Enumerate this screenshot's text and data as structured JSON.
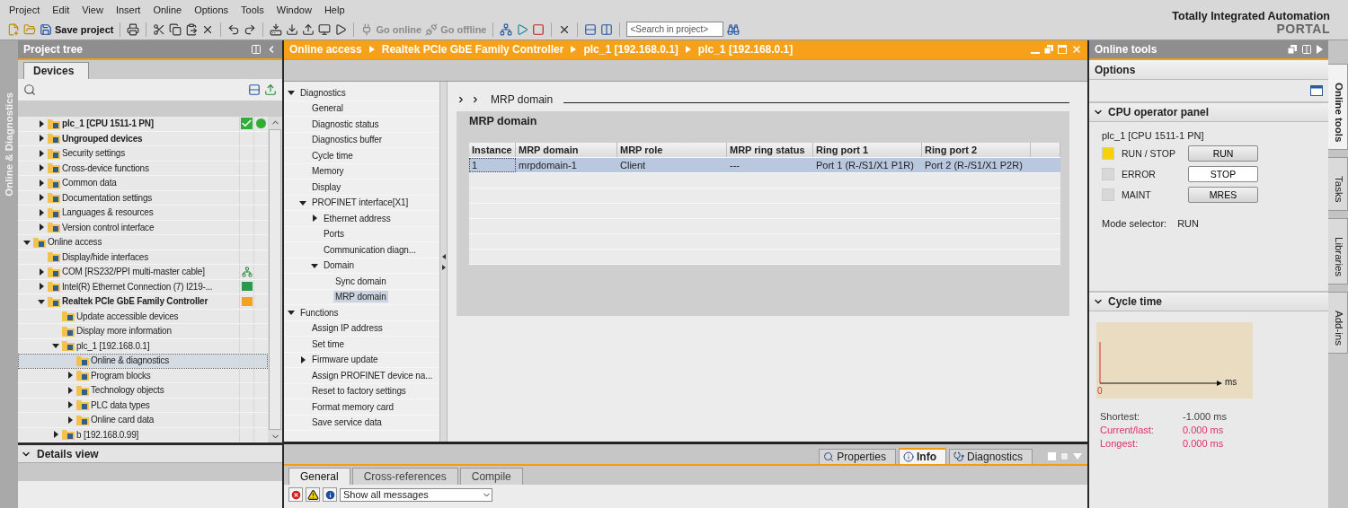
{
  "menu": [
    "Project",
    "Edit",
    "View",
    "Insert",
    "Online",
    "Options",
    "Tools",
    "Window",
    "Help"
  ],
  "toolbar": {
    "save_label": "Save project",
    "go_online": {
      "label": "Go online",
      "disabled": true
    },
    "go_offline": {
      "label": "Go offline",
      "disabled": true
    },
    "search_placeholder": "<Search in project>"
  },
  "brand": {
    "title": "Totally Integrated Automation",
    "subtitle": "PORTAL"
  },
  "left_strip": {
    "label": "Online & Diagnostics"
  },
  "project_tree": {
    "title": "Project tree",
    "tabs": [
      {
        "label": "Devices",
        "selected": true
      }
    ],
    "project_children": [
      {
        "label": "plc_1 [CPU 1511-1 PN]",
        "expanded": false,
        "selected": false,
        "bold": true,
        "status": {
          "kind": "ok"
        }
      },
      {
        "label": "Ungrouped devices",
        "expanded": false,
        "selected": false,
        "bold": true
      },
      {
        "label": "Security settings",
        "expanded": false,
        "selected": false,
        "bold": false
      },
      {
        "label": "Cross-device functions",
        "expanded": false,
        "selected": false,
        "bold": false
      },
      {
        "label": "Common data",
        "expanded": false,
        "selected": false,
        "bold": false
      },
      {
        "label": "Documentation settings",
        "expanded": false,
        "selected": false,
        "bold": false
      },
      {
        "label": "Languages & resources",
        "expanded": false,
        "selected": false,
        "bold": false
      },
      {
        "label": "Version control interface",
        "expanded": false,
        "selected": false,
        "bold": false
      }
    ],
    "items": [
      {
        "label": "Online access",
        "expanded": true,
        "selected": false,
        "bold": false,
        "children": [
          {
            "label": "Display/hide interfaces",
            "selected": false,
            "bold": false
          },
          {
            "label": "COM [RS232/PPI multi-master cable]",
            "expanded": false,
            "selected": false,
            "bold": false,
            "status": {
              "kind": "unknown"
            }
          },
          {
            "label": "Intel(R) Ethernet Connection (7) I219-...",
            "expanded": false,
            "selected": false,
            "bold": false,
            "status": {
              "kind": "connected"
            }
          },
          {
            "label": "Realtek PCIe GbE Family Controller",
            "expanded": true,
            "selected": false,
            "bold": true,
            "status": {
              "kind": "active"
            },
            "children": [
              {
                "label": "Update accessible devices",
                "selected": false,
                "bold": false
              },
              {
                "label": "Display more information",
                "selected": false,
                "bold": false
              },
              {
                "label": "plc_1 [192.168.0.1]",
                "expanded": true,
                "selected": false,
                "bold": false,
                "children": [
                  {
                    "label": "Online & diagnostics",
                    "selected": true,
                    "bold": false
                  },
                  {
                    "label": "Program blocks",
                    "expanded": false,
                    "selected": false,
                    "bold": false
                  },
                  {
                    "label": "Technology objects",
                    "expanded": false,
                    "selected": false,
                    "bold": false
                  },
                  {
                    "label": "PLC data types",
                    "expanded": false,
                    "selected": false,
                    "bold": false
                  },
                  {
                    "label": "Online card data",
                    "expanded": false,
                    "selected": false,
                    "bold": false
                  }
                ]
              },
              {
                "label": "b [192.168.0.99]",
                "expanded": false,
                "selected": false,
                "bold": false
              }
            ]
          }
        ]
      }
    ]
  },
  "details_view": {
    "title": "Details view",
    "expanded": true
  },
  "editor": {
    "breadcrumb": [
      "Online access",
      "Realtek PCIe GbE Family Controller",
      "plc_1 [192.168.0.1]",
      "plc_1 [192.168.0.1]"
    ],
    "nav": [
      {
        "label": "Diagnostics",
        "expanded": true,
        "selected": false,
        "children": [
          {
            "label": "General",
            "selected": false
          },
          {
            "label": "Diagnostic status",
            "selected": false
          },
          {
            "label": "Diagnostics buffer",
            "selected": false
          },
          {
            "label": "Cycle time",
            "selected": false
          },
          {
            "label": "Memory",
            "selected": false
          },
          {
            "label": "Display",
            "selected": false
          },
          {
            "label": "PROFINET interface[X1]",
            "expanded": true,
            "selected": false,
            "children": [
              {
                "label": "Ethernet address",
                "expanded": false,
                "selected": false
              },
              {
                "label": "Ports",
                "selected": false
              },
              {
                "label": "Communication diagn...",
                "selected": false
              },
              {
                "label": "Domain",
                "expanded": true,
                "selected": false,
                "children": [
                  {
                    "label": "Sync domain",
                    "selected": false
                  },
                  {
                    "label": "MRP domain",
                    "selected": true
                  }
                ]
              }
            ]
          }
        ]
      },
      {
        "label": "Functions",
        "expanded": true,
        "selected": false,
        "children": [
          {
            "label": "Assign IP address",
            "selected": false
          },
          {
            "label": "Set time",
            "selected": false
          },
          {
            "label": "Firmware update",
            "expanded": false,
            "selected": false
          },
          {
            "label": "Assign PROFINET device na...",
            "selected": false
          },
          {
            "label": "Reset to factory settings",
            "selected": false
          },
          {
            "label": "Format memory card",
            "selected": false
          },
          {
            "label": "Save service data",
            "selected": false
          }
        ]
      }
    ],
    "section_path": "MRP domain",
    "section_title": "MRP domain",
    "table": {
      "columns": [
        "Instance",
        "MRP domain",
        "MRP role",
        "MRP ring status",
        "Ring port 1",
        "Ring port 2"
      ],
      "rows": [
        {
          "cells": [
            "1",
            "mrpdomain-1",
            "Client",
            "---",
            "Port 1 (R-/S1/X1 P1R)",
            "Port 2 (R-/S1/X1 P2R)"
          ],
          "selected": true
        }
      ]
    }
  },
  "inspector": {
    "tabs": [
      {
        "label": "Properties",
        "selected": false
      },
      {
        "label": "Info",
        "selected": true
      },
      {
        "label": "Diagnostics",
        "selected": false
      }
    ],
    "subtabs": [
      {
        "label": "General",
        "selected": true
      },
      {
        "label": "Cross-references",
        "selected": false
      },
      {
        "label": "Compile",
        "selected": false
      }
    ],
    "filter": "Show all messages"
  },
  "online_tools": {
    "title": "Online tools",
    "options_label": "Options",
    "cpu_panel": {
      "title": "CPU operator panel",
      "expanded": true,
      "device": "plc_1 [CPU 1511-1 PN]",
      "rows": [
        {
          "led": {
            "label": "RUN / STOP",
            "on": true
          },
          "button": {
            "label": "RUN",
            "selected": false
          }
        },
        {
          "led": {
            "label": "ERROR",
            "on": false
          },
          "button": {
            "label": "STOP",
            "selected": true
          }
        },
        {
          "led": {
            "label": "MAINT",
            "on": false
          },
          "button": {
            "label": "MRES",
            "selected": false
          }
        }
      ],
      "mode_label": "Mode selector:",
      "mode_value": "RUN"
    },
    "cycle_time": {
      "title": "Cycle time",
      "expanded": true,
      "origin_label": "0",
      "unit_label": "ms",
      "stats": [
        {
          "label": "Shortest:",
          "value": "-1.000 ms",
          "color": "#404040"
        },
        {
          "label": "Current/last:",
          "value": "0.000 ms",
          "color": "#e0306a"
        },
        {
          "label": "Longest:",
          "value": "0.000 ms",
          "color": "#e0306a"
        }
      ]
    }
  },
  "right_tabs": [
    {
      "label": "Online tools",
      "selected": true
    },
    {
      "label": "Tasks",
      "selected": false
    },
    {
      "label": "Libraries",
      "selected": false
    },
    {
      "label": "Add-ins",
      "selected": false
    }
  ]
}
